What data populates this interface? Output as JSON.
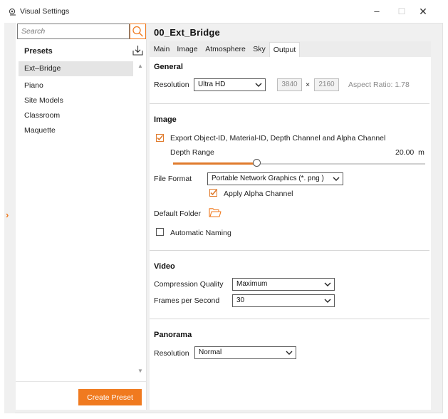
{
  "window": {
    "title": "Visual Settings",
    "controls": {
      "minimize": "–",
      "maximize": "☐",
      "close": "✕"
    }
  },
  "left_panel": {
    "search_placeholder": "Search",
    "presets_title": "Presets",
    "presets": [
      "Ext–Bridge",
      "Piano",
      "Site Models",
      "Classroom",
      "Maquette"
    ],
    "selected_preset": "Ext–Bridge",
    "create_button": "Create Preset"
  },
  "right_panel": {
    "preset_name": "00_Ext_Bridge",
    "tabs": [
      "Main",
      "Image",
      "Atmosphere",
      "Sky",
      "Output"
    ],
    "active_tab": "Output",
    "general": {
      "title": "General",
      "resolution_label": "Resolution",
      "resolution_value": "Ultra HD",
      "width": "3840",
      "times": "×",
      "height": "2160",
      "aspect_ratio": "Aspect Ratio: 1.78"
    },
    "image": {
      "title": "Image",
      "export_checkbox_label": "Export Object-ID, Material-ID, Depth Channel and Alpha Channel",
      "export_checked": true,
      "depth_range_label": "Depth Range",
      "depth_range_value": "20.00",
      "depth_range_unit": "m",
      "depth_slider_fraction": 0.33,
      "file_format_label": "File Format",
      "file_format_value": "Portable Network Graphics  (*. png )",
      "alpha_checkbox_label": "Apply Alpha Channel",
      "alpha_checked": true,
      "default_folder_label": "Default Folder",
      "auto_naming_label": "Automatic Naming",
      "auto_naming_checked": false
    },
    "video": {
      "title": "Video",
      "compression_label": "Compression Quality",
      "compression_value": "Maximum",
      "fps_label": "Frames per Second",
      "fps_value": "30"
    },
    "panorama": {
      "title": "Panorama",
      "resolution_label": "Resolution",
      "resolution_value": "Normal"
    }
  },
  "colors": {
    "accent": "#f07a1f",
    "panel_bg": "#f0f0f0",
    "selected_item": "#e5e5e5"
  },
  "icons": [
    "app-icon",
    "search-icon",
    "import-icon",
    "folder-icon",
    "chevron-down-icon",
    "expand-arrow-icon"
  ]
}
